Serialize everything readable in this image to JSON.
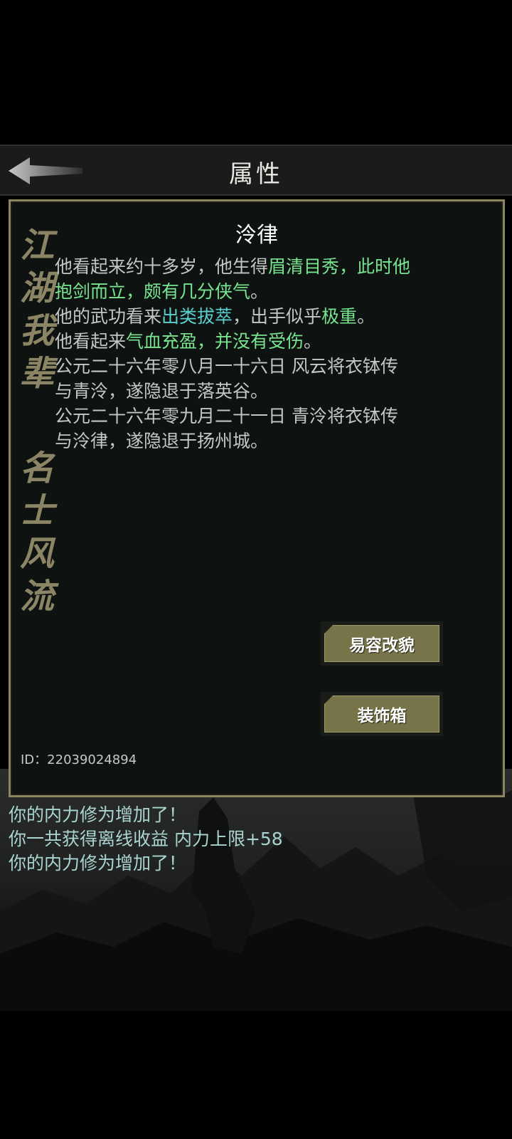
{
  "header": {
    "title": "属性",
    "back_icon": "back-arrow-icon"
  },
  "panel": {
    "decor_text_1": [
      "江",
      "湖",
      "我",
      "辈"
    ],
    "decor_text_2": [
      "名",
      "士",
      "风",
      "流"
    ],
    "character_name": "泠律",
    "description": [
      [
        {
          "text": "他看起来约十多岁，他生得",
          "style": "normal"
        },
        {
          "text": "眉清目秀，此时他",
          "style": "green"
        }
      ],
      [
        {
          "text": "抱剑而立，颇有几分侠气",
          "style": "green"
        },
        {
          "text": "。",
          "style": "normal"
        }
      ],
      [
        {
          "text": "他的武功看来",
          "style": "normal"
        },
        {
          "text": "出类拔萃",
          "style": "cyan"
        },
        {
          "text": "，出手似乎",
          "style": "normal"
        },
        {
          "text": "极重",
          "style": "green"
        },
        {
          "text": "。",
          "style": "normal"
        }
      ],
      [
        {
          "text": "他看起来",
          "style": "normal"
        },
        {
          "text": "气血充盈，并没有受伤",
          "style": "green"
        },
        {
          "text": "。",
          "style": "normal"
        }
      ],
      [
        {
          "text": "公元二十六年零八月一十六日 风云将衣钵传",
          "style": "normal"
        }
      ],
      [
        {
          "text": "与青泠，遂隐退于落英谷。",
          "style": "normal"
        }
      ],
      [
        {
          "text": "公元二十六年零九月二十一日 青泠将衣钵传",
          "style": "normal"
        }
      ],
      [
        {
          "text": "与泠律，遂隐退于扬州城。",
          "style": "normal"
        }
      ]
    ],
    "buttons": {
      "change_appearance": "易容改貌",
      "decoration_box": "装饰箱"
    },
    "id_text": "ID：22039024894"
  },
  "log": [
    "你的内力修为增加了！",
    "你一共获得离线收益 内力上限+58",
    "你的内力修为增加了！"
  ],
  "colors": {
    "panel_border": "#8a8460",
    "highlight_green": "#77e590",
    "highlight_cyan": "#5ad0cf",
    "button_face": "#767448",
    "log_text": "#a9d4cf"
  }
}
